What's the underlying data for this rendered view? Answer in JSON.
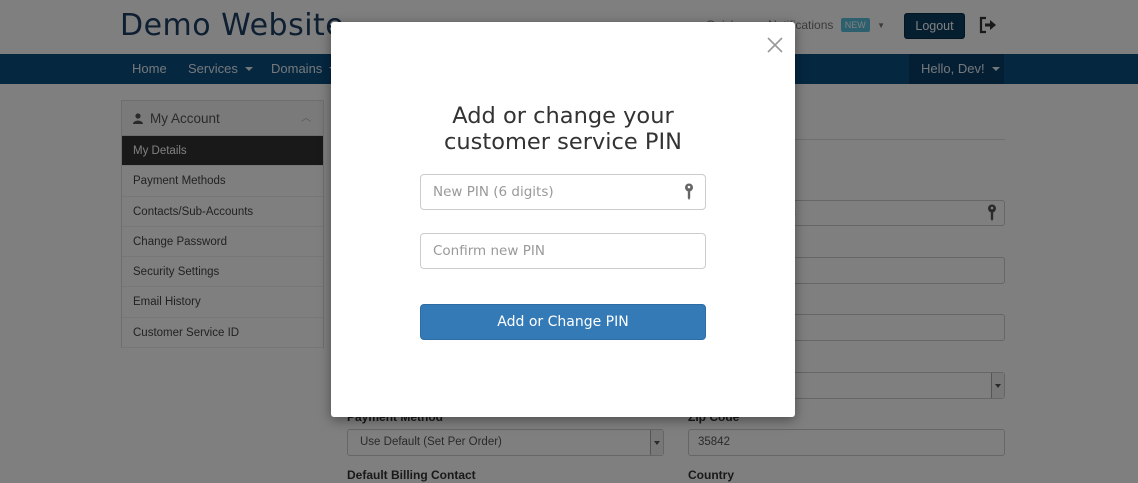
{
  "header": {
    "site_title": "Demo Website",
    "links_partial": "Quick...",
    "notifications_label": "Notifications",
    "new_badge": "NEW",
    "logout_label": "Logout",
    "icons": {
      "signout": "sign-out-icon",
      "caret": "caret-down-icon"
    }
  },
  "navbar": {
    "items": [
      {
        "label": "Home"
      },
      {
        "label": "Services"
      },
      {
        "label": "Domains"
      }
    ],
    "user_menu": "Hello, Dev!"
  },
  "sidebar": {
    "title": "My Account",
    "items": [
      {
        "label": "My Details",
        "active": true
      },
      {
        "label": "Payment Methods"
      },
      {
        "label": "Contacts/Sub-Accounts"
      },
      {
        "label": "Change Password"
      },
      {
        "label": "Security Settings"
      },
      {
        "label": "Email History"
      },
      {
        "label": "Customer Service ID"
      }
    ]
  },
  "background_form": {
    "pin_field_partial": "a",
    "payment_method_label": "Payment Method",
    "payment_method_value": "Use Default (Set Per Order)",
    "zip_label": "Zip Code",
    "zip_value": "35842",
    "billing_contact_label": "Default Billing Contact",
    "country_label": "Country"
  },
  "modal": {
    "title_line1": "Add or change your",
    "title_line2": "customer service PIN",
    "new_pin_placeholder": "New PIN (6 digits)",
    "confirm_pin_placeholder": "Confirm new PIN",
    "submit_label": "Add or Change PIN",
    "icons": {
      "close": "close-icon",
      "key": "key-icon"
    }
  },
  "colors": {
    "brand_dark": "#0b3c61",
    "nav_blue": "#0a4e80",
    "primary_button": "#337ab7",
    "badge": "#5bc0de"
  }
}
